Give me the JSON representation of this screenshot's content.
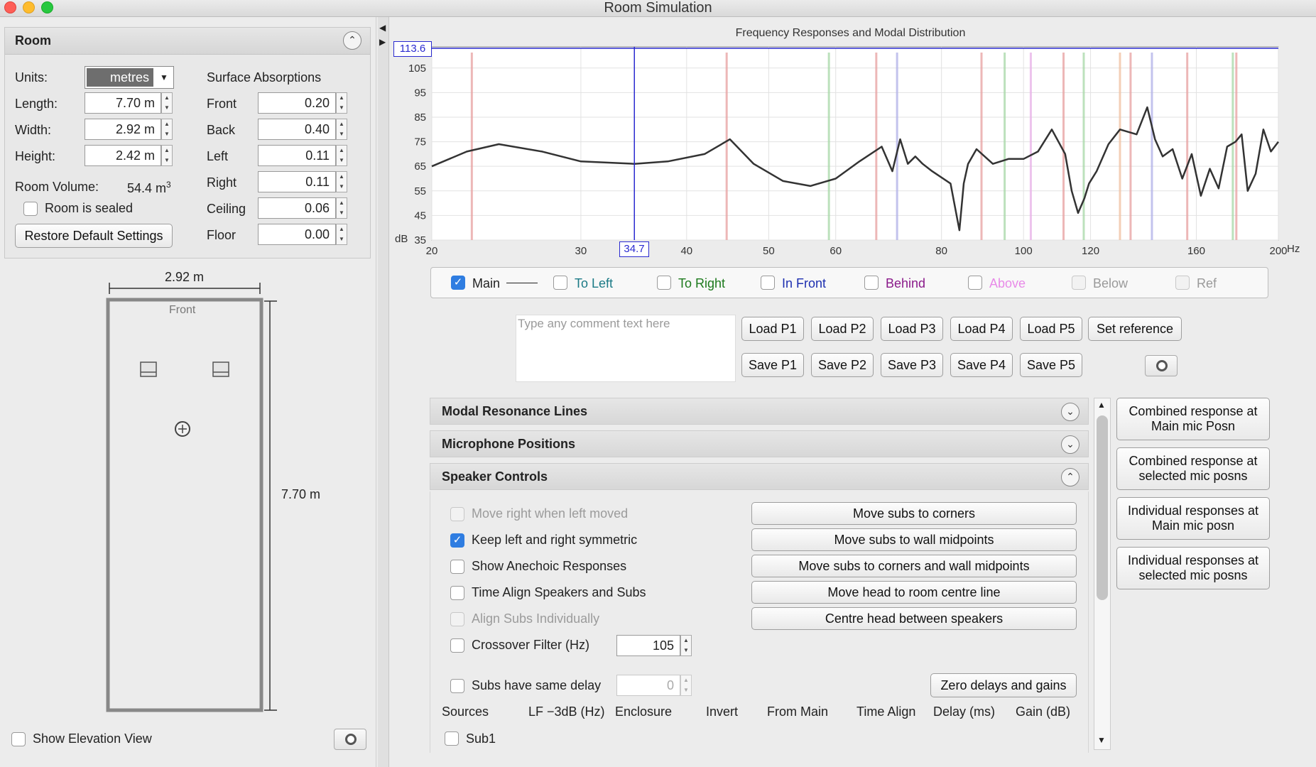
{
  "window": {
    "title": "Room Simulation"
  },
  "room": {
    "header": "Room",
    "units_label": "Units:",
    "units_value": "metres",
    "length_label": "Length:",
    "length_value": "7.70 m",
    "width_label": "Width:",
    "width_value": "2.92 m",
    "height_label": "Height:",
    "height_value": "2.42 m",
    "volume_label": "Room Volume:",
    "volume_value": "54.4 m",
    "volume_unit_sup": "3",
    "sealed_label": "Room is sealed",
    "restore_label": "Restore Default Settings",
    "absorption_header": "Surface Absorptions",
    "surfaces": [
      {
        "label": "Front",
        "value": "0.20"
      },
      {
        "label": "Back",
        "value": "0.40"
      },
      {
        "label": "Left",
        "value": "0.11"
      },
      {
        "label": "Right",
        "value": "0.11"
      },
      {
        "label": "Ceiling",
        "value": "0.06"
      },
      {
        "label": "Floor",
        "value": "0.00"
      }
    ]
  },
  "plan": {
    "width_dim": "2.92 m",
    "length_dim": "7.70 m",
    "front_label": "Front",
    "elevation_label": "Show Elevation View"
  },
  "chart": {
    "title": "Frequency Responses and Modal Distribution",
    "top_value": "113.6",
    "cursor_value": "34.7",
    "ylabel": "dB",
    "xunit": "Hz"
  },
  "chart_data": {
    "type": "line",
    "title": "Frequency Responses and Modal Distribution",
    "xscale": "log",
    "xlim": [
      20,
      200
    ],
    "ylim": [
      35,
      113.6
    ],
    "xticks": [
      20,
      30,
      40,
      50,
      60,
      80,
      100,
      120,
      160,
      200
    ],
    "yticks": [
      35,
      45,
      55,
      65,
      75,
      85,
      95,
      105
    ],
    "cursor_x": 34.7,
    "cursor_y": 113.6,
    "series": [
      {
        "name": "Main",
        "x": [
          20,
          22,
          24,
          27,
          30,
          34.7,
          38,
          42,
          45,
          48,
          52,
          56,
          60,
          64,
          68,
          70,
          71.5,
          73,
          74.5,
          76,
          78,
          82,
          84,
          85,
          86,
          88,
          92,
          96,
          100,
          104,
          108,
          112,
          114,
          116,
          118,
          119.5,
          122,
          126,
          130,
          136,
          140,
          143,
          146,
          150,
          154,
          158,
          162,
          166,
          170,
          174,
          178,
          181,
          184,
          188,
          192,
          196,
          200
        ],
        "y": [
          65,
          71,
          74,
          71,
          67,
          66,
          67,
          70,
          76,
          66,
          59,
          57,
          60,
          67,
          73,
          63,
          76,
          66,
          69,
          66,
          63,
          58,
          39,
          58,
          66,
          72,
          66,
          68,
          68,
          71,
          80,
          70,
          55,
          46,
          52,
          58,
          63,
          74,
          80,
          78,
          89,
          76,
          69,
          72,
          60,
          70,
          53,
          64,
          56,
          73,
          75,
          78,
          55,
          62,
          80,
          71,
          75
        ]
      }
    ],
    "modes": [
      {
        "x": 22.3,
        "color": "#e8a0a0"
      },
      {
        "x": 44.6,
        "color": "#e8a0a0"
      },
      {
        "x": 58.9,
        "color": "#a6d8a6"
      },
      {
        "x": 67,
        "color": "#e8a0a0"
      },
      {
        "x": 70.9,
        "color": "#b0b0e8"
      },
      {
        "x": 89.2,
        "color": "#e8a0a0"
      },
      {
        "x": 95,
        "color": "#a6d8a6"
      },
      {
        "x": 102,
        "color": "#e8b0e8"
      },
      {
        "x": 111.5,
        "color": "#e8a0a0"
      },
      {
        "x": 117.8,
        "color": "#a6d8a6"
      },
      {
        "x": 130,
        "color": "#f0c0a0"
      },
      {
        "x": 133.8,
        "color": "#e8a0a0"
      },
      {
        "x": 141.8,
        "color": "#b0b0e8"
      },
      {
        "x": 156.1,
        "color": "#e8a0a0"
      },
      {
        "x": 176.7,
        "color": "#a6d8a6"
      },
      {
        "x": 178.4,
        "color": "#e8a0a0"
      }
    ]
  },
  "legend": [
    {
      "label": "Main",
      "checked": true,
      "color": "#222222",
      "disabled": false
    },
    {
      "label": "To Left",
      "checked": false,
      "color": "#1b7a86",
      "disabled": false
    },
    {
      "label": "To Right",
      "checked": false,
      "color": "#1d7a1d",
      "disabled": false
    },
    {
      "label": "In Front",
      "checked": false,
      "color": "#1d2fb0",
      "disabled": false
    },
    {
      "label": "Behind",
      "checked": false,
      "color": "#8a1a8a",
      "disabled": false
    },
    {
      "label": "Above",
      "checked": false,
      "color": "#e88ae8",
      "disabled": false
    },
    {
      "label": "Below",
      "checked": false,
      "color": "#9a9a9a",
      "disabled": true
    },
    {
      "label": "Ref",
      "checked": false,
      "color": "#9a9a9a",
      "disabled": true
    }
  ],
  "comment": {
    "placeholder": "Type any comment text here"
  },
  "presets": {
    "load": [
      "Load P1",
      "Load P2",
      "Load P3",
      "Load P4",
      "Load P5"
    ],
    "save": [
      "Save P1",
      "Save P2",
      "Save P3",
      "Save P4",
      "Save P5"
    ],
    "set_reference": "Set reference"
  },
  "sections": {
    "modal": "Modal Resonance Lines",
    "mic": "Microphone Positions",
    "speaker": "Speaker Controls"
  },
  "speaker": {
    "options": [
      {
        "label": "Move right when left moved",
        "checked": false,
        "disabled": true
      },
      {
        "label": "Keep left and right symmetric",
        "checked": true,
        "disabled": false
      },
      {
        "label": "Show Anechoic Responses",
        "checked": false,
        "disabled": false
      },
      {
        "label": "Time Align Speakers and Subs",
        "checked": false,
        "disabled": false
      },
      {
        "label": "Align Subs Individually",
        "checked": false,
        "disabled": true
      },
      {
        "label": "Crossover Filter (Hz)",
        "checked": false,
        "disabled": false
      }
    ],
    "crossover_value": "105",
    "same_delay_label": "Subs have same delay",
    "same_delay_value": "0",
    "actions": [
      "Move subs to corners",
      "Move subs to wall midpoints",
      "Move subs to corners and wall midpoints",
      "Move head to room centre line",
      "Centre head between speakers"
    ],
    "zero_label": "Zero delays and gains",
    "columns": [
      "Sources",
      "LF −3dB (Hz)",
      "Enclosure",
      "Invert",
      "From Main",
      "Time Align",
      "Delay (ms)",
      "Gain (dB)"
    ],
    "sub1": "Sub1"
  },
  "side_buttons": [
    {
      "line1": "Combined response at",
      "line2": "Main mic Posn"
    },
    {
      "line1": "Combined response at",
      "line2": "selected mic posns"
    },
    {
      "line1": "Individual responses at",
      "line2": "Main mic posn"
    },
    {
      "line1": "Individual responses at",
      "line2": "selected mic posns"
    }
  ]
}
